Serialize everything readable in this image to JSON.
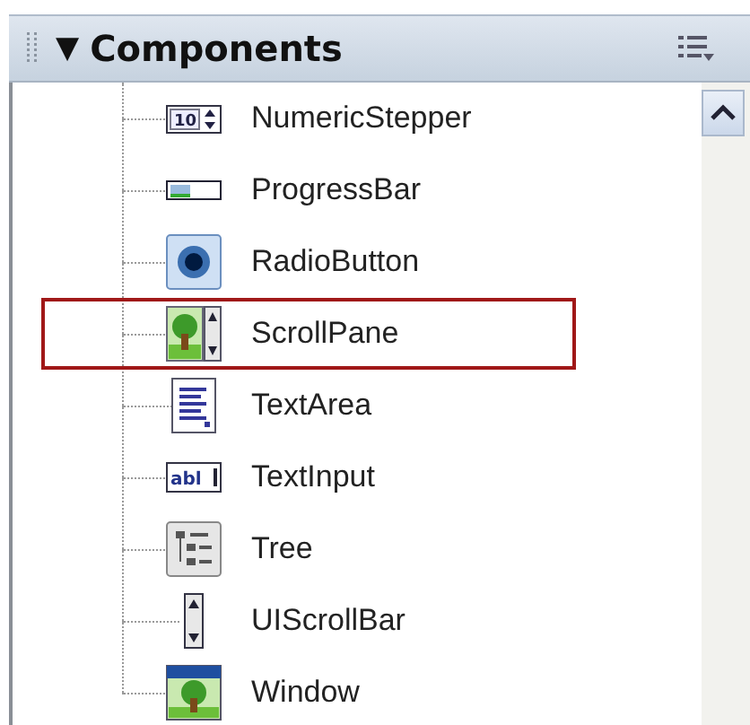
{
  "panel": {
    "toggle": "▼",
    "title": "Components"
  },
  "items": [
    {
      "label": "NumericStepper",
      "selected": false,
      "icon_text": "10"
    },
    {
      "label": "ProgressBar",
      "selected": false
    },
    {
      "label": "RadioButton",
      "selected": false
    },
    {
      "label": "ScrollPane",
      "selected": true
    },
    {
      "label": "TextArea",
      "selected": false
    },
    {
      "label": "TextInput",
      "selected": false,
      "icon_text": "abl"
    },
    {
      "label": "Tree",
      "selected": false
    },
    {
      "label": "UIScrollBar",
      "selected": false
    },
    {
      "label": "Window",
      "selected": false
    }
  ]
}
